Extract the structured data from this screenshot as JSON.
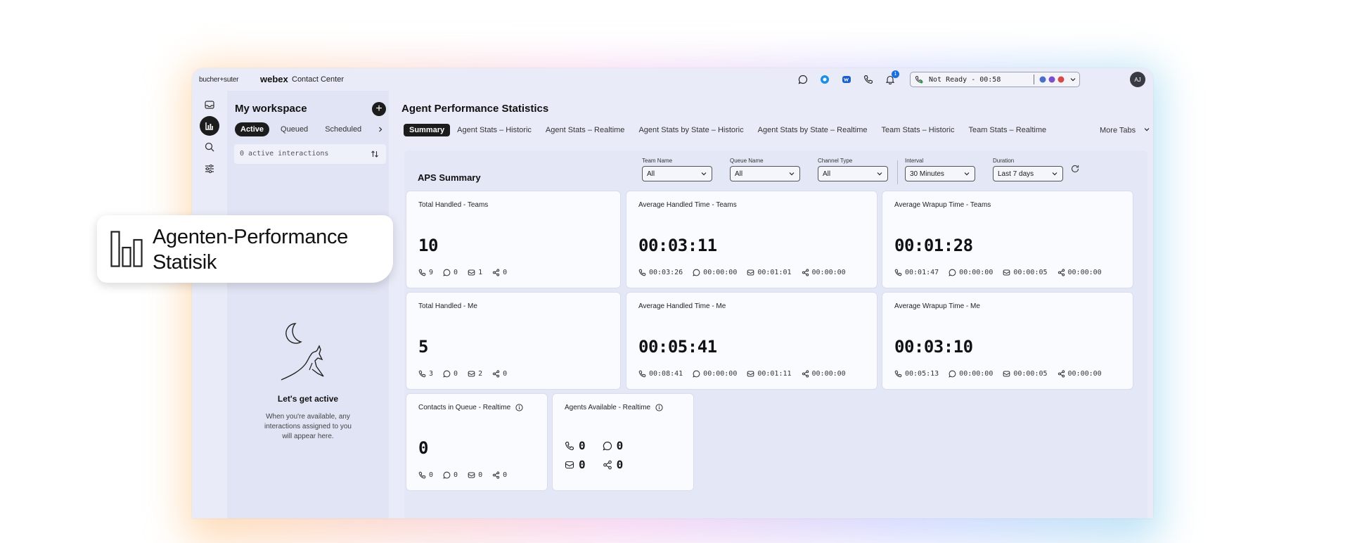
{
  "app": {
    "brand_left": "bucher+suter",
    "brand_webex": "webex",
    "brand_cc": "Contact Center",
    "agent_status": "Not Ready - 00:58",
    "notification_count": "1",
    "avatar_initials": "AJ"
  },
  "sidebar": {
    "icons": [
      "inbox-icon",
      "stats-icon",
      "search-icon",
      "settings-sliders-icon"
    ]
  },
  "workspace": {
    "title": "My workspace",
    "tabs": [
      "Active",
      "Queued",
      "Scheduled"
    ],
    "active_tab": "Active",
    "search_text": "0 active interactions",
    "empty_title": "Let's get active",
    "empty_text": "When you're available, any interactions assigned to you will appear here."
  },
  "main": {
    "title": "Agent Performance Statistics",
    "tabs": [
      "Summary",
      "Agent Stats – Historic",
      "Agent Stats – Realtime",
      "Agent Stats by State – Historic",
      "Agent Stats by State – Realtime",
      "Team Stats – Historic",
      "Team Stats – Realtime"
    ],
    "more_tabs": "More Tabs",
    "section_title": "APS Summary",
    "filters": [
      {
        "label": "Team Name",
        "value": "All"
      },
      {
        "label": "Queue Name",
        "value": "All"
      },
      {
        "label": "Channel Type",
        "value": "All"
      },
      {
        "label": "Interval",
        "value": "30 Minutes"
      },
      {
        "label": "Duration",
        "value": "Last 7 days"
      }
    ],
    "cards": [
      {
        "title": "Total Handled - Teams",
        "value": "10",
        "stats": [
          "9",
          "0",
          "1",
          "0"
        ]
      },
      {
        "title": "Average Handled Time - Teams",
        "value": "00:03:11",
        "stats": [
          "00:03:26",
          "00:00:00",
          "00:01:01",
          "00:00:00"
        ]
      },
      {
        "title": "Average Wrapup Time - Teams",
        "value": "00:01:28",
        "stats": [
          "00:01:47",
          "00:00:00",
          "00:00:05",
          "00:00:00"
        ]
      },
      {
        "title": "Total Handled - Me",
        "value": "5",
        "stats": [
          "3",
          "0",
          "2",
          "0"
        ]
      },
      {
        "title": "Average Handled Time - Me",
        "value": "00:05:41",
        "stats": [
          "00:08:41",
          "00:00:00",
          "00:01:11",
          "00:00:00"
        ]
      },
      {
        "title": "Average Wrapup Time - Me",
        "value": "00:03:10",
        "stats": [
          "00:05:13",
          "00:00:00",
          "00:00:05",
          "00:00:00"
        ]
      },
      {
        "title": "Contacts in Queue - Realtime",
        "value": "0",
        "stats": [
          "0",
          "0",
          "0",
          "0"
        ]
      },
      {
        "title": "Agents Available - Realtime",
        "stats": [
          "0",
          "0",
          "0",
          "0"
        ]
      }
    ]
  },
  "callout": {
    "line1": "Agenten-Performance",
    "line2": "Statisik"
  },
  "colors": {
    "window_bg": "#e9ecf8",
    "accent_dark": "#1c1c1c"
  }
}
